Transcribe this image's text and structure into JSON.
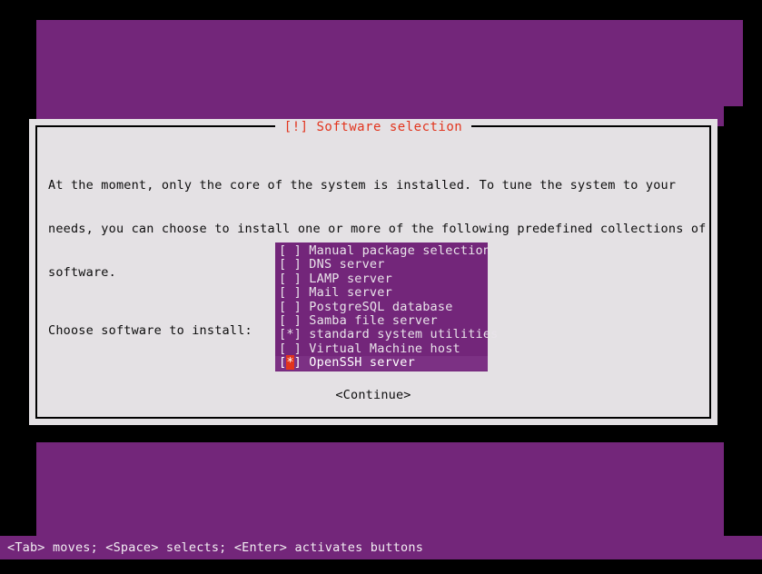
{
  "colors": {
    "desktop_purple": "#73267a",
    "dialog_bg": "#e4e1e4",
    "title_red": "#e2341d",
    "list_bg": "#73267a",
    "list_selected_bg": "#7c3184",
    "checkbox_mark_bg": "#e2341d",
    "text_dark": "#0d0d0d",
    "text_light": "#e9e4ea",
    "shadow": "#000000"
  },
  "dialog": {
    "title": "[!] Software selection",
    "paragraph_lines": [
      "At the moment, only the core of the system is installed. To tune the system to your",
      "needs, you can choose to install one or more of the following predefined collections of",
      "software."
    ],
    "prompt": "Choose software to install:",
    "continue_label": "<Continue>"
  },
  "software_list": [
    {
      "checkbox": "[ ]",
      "mark": " ",
      "label": "Manual package selection",
      "checked": false,
      "selected": false
    },
    {
      "checkbox": "[ ]",
      "mark": " ",
      "label": "DNS server",
      "checked": false,
      "selected": false
    },
    {
      "checkbox": "[ ]",
      "mark": " ",
      "label": "LAMP server",
      "checked": false,
      "selected": false
    },
    {
      "checkbox": "[ ]",
      "mark": " ",
      "label": "Mail server",
      "checked": false,
      "selected": false
    },
    {
      "checkbox": "[ ]",
      "mark": " ",
      "label": "PostgreSQL database",
      "checked": false,
      "selected": false
    },
    {
      "checkbox": "[ ]",
      "mark": " ",
      "label": "Samba file server",
      "checked": false,
      "selected": false
    },
    {
      "checkbox": "[*]",
      "mark": "*",
      "label": "standard system utilities",
      "checked": true,
      "selected": false
    },
    {
      "checkbox": "[ ]",
      "mark": " ",
      "label": "Virtual Machine host",
      "checked": false,
      "selected": false
    },
    {
      "checkbox": "[*]",
      "mark": "*",
      "label": "OpenSSH server",
      "checked": true,
      "selected": true
    }
  ],
  "statusbar": {
    "hint": "<Tab> moves; <Space> selects; <Enter> activates buttons"
  }
}
